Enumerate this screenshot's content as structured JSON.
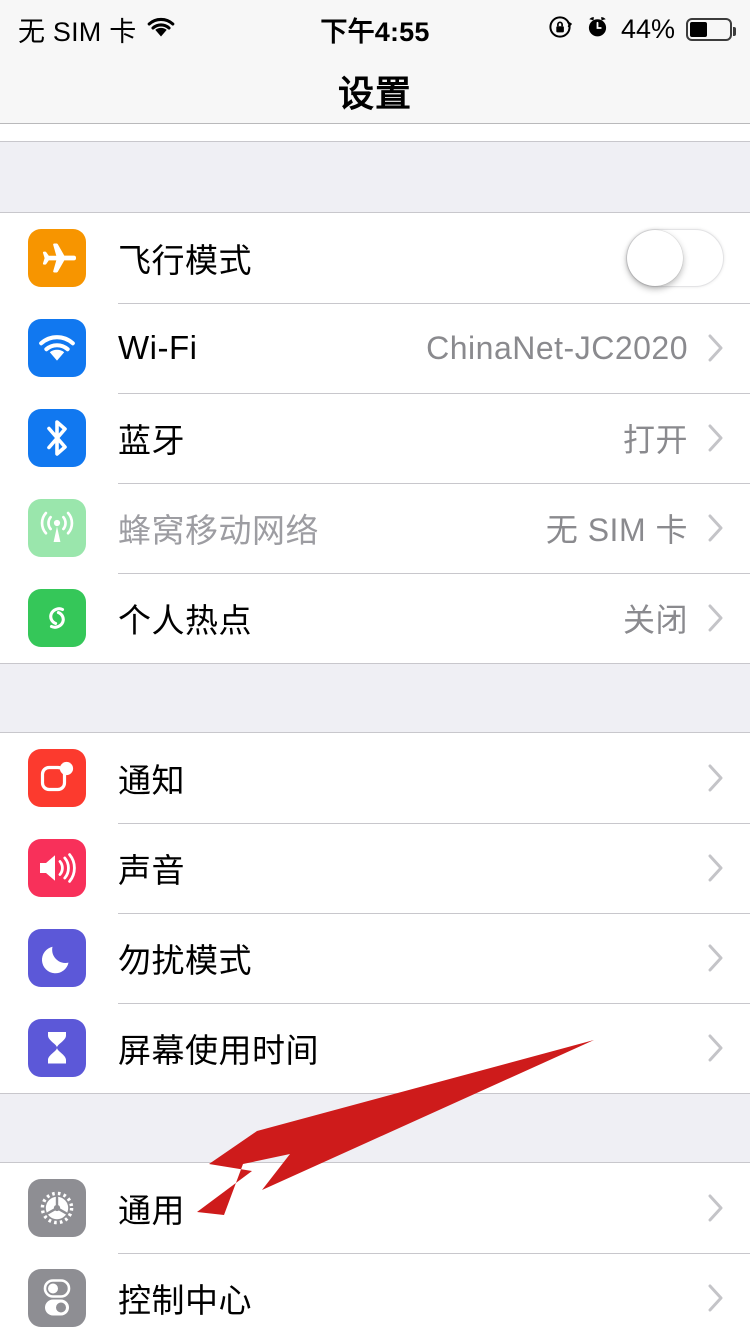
{
  "status_bar": {
    "carrier": "无 SIM 卡",
    "wifi_icon": "wifi-icon",
    "time": "下午4:55",
    "rotation_lock_icon": "rotation-lock-icon",
    "alarm_icon": "alarm-clock-icon",
    "battery_percent": "44%",
    "battery_level": 44
  },
  "navbar": {
    "title": "设置"
  },
  "sections": [
    {
      "rows": [
        {
          "icon": "airplane-icon",
          "icon_color": "#F79500",
          "label": "飞行模式",
          "control": "toggle",
          "toggle_on": false
        },
        {
          "icon": "wifi-icon",
          "icon_color": "#1178F0",
          "label": "Wi-Fi",
          "value": "ChinaNet-JC2020",
          "control": "chevron"
        },
        {
          "icon": "bluetooth-icon",
          "icon_color": "#1178F0",
          "label": "蓝牙",
          "value": "打开",
          "control": "chevron"
        },
        {
          "icon": "cellular-icon",
          "icon_color": "#9AE6AC",
          "label": "蜂窝移动网络",
          "value": "无 SIM 卡",
          "control": "chevron",
          "disabled": true
        },
        {
          "icon": "hotspot-icon",
          "icon_color": "#35C759",
          "label": "个人热点",
          "value": "关闭",
          "control": "chevron"
        }
      ]
    },
    {
      "rows": [
        {
          "icon": "notifications-icon",
          "icon_color": "#FC3A2E",
          "label": "通知",
          "value": "",
          "control": "chevron"
        },
        {
          "icon": "sounds-icon",
          "icon_color": "#F8305A",
          "label": "声音",
          "value": "",
          "control": "chevron"
        },
        {
          "icon": "moon-icon",
          "icon_color": "#5C58D8",
          "label": "勿扰模式",
          "value": "",
          "control": "chevron"
        },
        {
          "icon": "hourglass-icon",
          "icon_color": "#5C58D8",
          "label": "屏幕使用时间",
          "value": "",
          "control": "chevron"
        }
      ]
    },
    {
      "rows": [
        {
          "icon": "gear-icon",
          "icon_color": "#8E8E93",
          "label": "通用",
          "value": "",
          "control": "chevron"
        },
        {
          "icon": "control-center-icon",
          "icon_color": "#8E8E93",
          "label": "控制中心",
          "value": "",
          "control": "chevron"
        }
      ]
    }
  ],
  "annotation": {
    "type": "arrow",
    "color": "#CE1B1B",
    "points_to": "通用"
  }
}
